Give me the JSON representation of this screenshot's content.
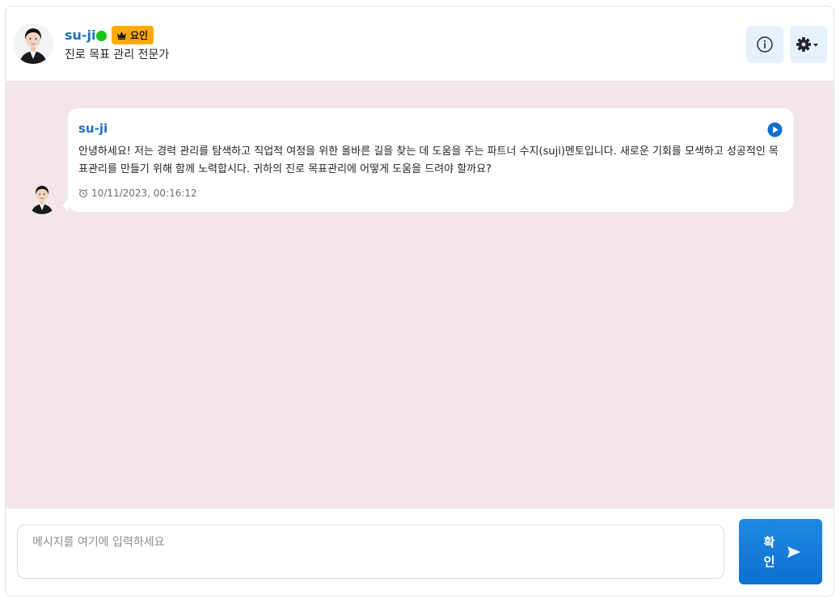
{
  "header": {
    "name": "su-ji",
    "badge": "요인",
    "role": "진로 목표 관리 전문가",
    "status_color": "#14c814",
    "badge_color": "#ffa900"
  },
  "messages": [
    {
      "sender": "su-ji",
      "text": "안녕하세요! 저는 경력 관리를 탐색하고 직업적 여정을 위한 올바른 길을 찾는 데 도움을 주는 파트너 수지(suji)멘토입니다. 새로운 기회를 모색하고 성공적인 목표관리를 만들기 위해 함께 노력합시다. 귀하의 진로 목표관리에 어떻게 도움을 드려야 할까요?",
      "timestamp": "10/11/2023, 00:16:12"
    }
  ],
  "composer": {
    "placeholder": "메시지를 여기에 입력하세요",
    "value": "",
    "send_label": "확인"
  },
  "icons": {
    "info": "info-icon",
    "settings": "gear-icon",
    "play": "play-icon",
    "clock": "alarm-clock-icon",
    "send": "send-arrow-icon",
    "crown": "crown-icon"
  },
  "colors": {
    "accent": "#1f6fbf",
    "chat_background": "#f2e6e8",
    "send_button": "#0d6fd0"
  }
}
